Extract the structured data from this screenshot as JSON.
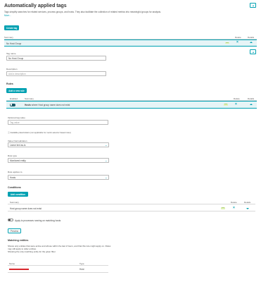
{
  "page": {
    "title": "Automatically applied tags",
    "description": "Tags simplify searches for related services, process groups, and hosts. They also facilitate the collection of related metrics into meaningful groups for analysis.",
    "more_label": "More..."
  },
  "toolbar": {
    "create_tag_label": "Create tag"
  },
  "tags_table": {
    "headers": {
      "summary": "Summary",
      "delete": "Delete",
      "details": "Details"
    },
    "rows": [
      {
        "summary": "No Host Group",
        "badge": "new"
      }
    ]
  },
  "tag_form": {
    "name_label": "Tag name",
    "name_value": "No Host Group",
    "description_label": "Description",
    "description_placeholder": "Add a description"
  },
  "rules": {
    "title": "Rules",
    "add_rule_label": "Add a new rule",
    "headers": {
      "enabled": "Enabled",
      "summary": "Summary",
      "delete": "Delete",
      "details": "Details"
    },
    "rule": {
      "summary_prefix": "Hosts",
      "summary_rest": "where Host group name does not exist",
      "badge": "new",
      "enabled": true
    },
    "optional_value_label": "Optional tag value",
    "optional_value_placeholder": "Tag value",
    "note": "Available placeholders (not applicable for metric-selector based rules)",
    "value_normalization_label": "Value Normalization",
    "value_normalization_value": "Leave text as-is",
    "rule_type_label": "Rule type",
    "rule_type_value": "Monitored entity",
    "rule_applies_label": "Rule applies to",
    "rule_applies_value": "Hosts"
  },
  "conditions": {
    "title": "Conditions",
    "add_condition_label": "Add condition",
    "headers": {
      "summary": "Summary",
      "delete": "Delete",
      "details": "Details"
    },
    "row": {
      "summary": "Host group name does not exist",
      "badge": "new"
    }
  },
  "apply_processes": {
    "label": "Apply to processes running on matching hosts",
    "enabled": false
  },
  "preview_label": "Preview",
  "matching": {
    "title": "Matching entities",
    "description": "Shows only entities that were active and whose within the last 2 hours, and that this rule might apply on. Rules may still apply to older entities.",
    "description2": "Showing the only matching entity for the given filter.",
    "headers": {
      "name": "Name",
      "type": "Type"
    },
    "rows": [
      {
        "type": "Host"
      }
    ]
  },
  "colors": {
    "accent": "#00a1b2",
    "selected_bg": "#e6f4f6",
    "badge_bg": "#e0f2b8",
    "redacted": "#d9262c"
  }
}
